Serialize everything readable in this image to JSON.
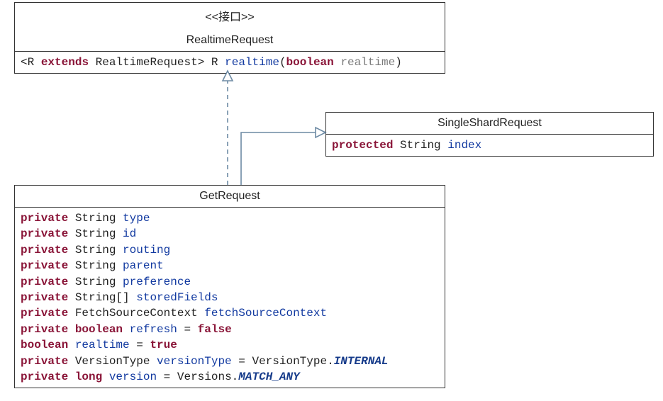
{
  "interface": {
    "stereotype": "<<接口>>",
    "name": "RealtimeRequest",
    "method": {
      "prefix": "<",
      "generic": "R",
      "extends_kw": "extends",
      "extends_type": "RealtimeRequest",
      "close": ">",
      "return": "R",
      "method_name": "realtime",
      "param_type_kw": "boolean",
      "param_name": "realtime"
    }
  },
  "singleShard": {
    "name": "SingleShardRequest",
    "field": {
      "mod": "protected",
      "type": "String",
      "name": "index"
    }
  },
  "getRequest": {
    "name": "GetRequest",
    "fields": [
      {
        "mod": "private",
        "type": "String",
        "name": "type"
      },
      {
        "mod": "private",
        "type": "String",
        "name": "id"
      },
      {
        "mod": "private",
        "type": "String",
        "name": "routing"
      },
      {
        "mod": "private",
        "type": "String",
        "name": "parent"
      },
      {
        "mod": "private",
        "type": "String",
        "name": "preference"
      },
      {
        "mod": "private",
        "type": "String[]",
        "name": "storedFields"
      },
      {
        "mod": "private",
        "type": "FetchSourceContext",
        "name": "fetchSourceContext"
      },
      {
        "mod": "private",
        "type_kw": "boolean",
        "name": "refresh",
        "eq": "=",
        "lit": "false"
      },
      {
        "type_kw": "boolean",
        "name": "realtime",
        "eq": "=",
        "lit": "true"
      },
      {
        "mod": "private",
        "type": "VersionType",
        "name": "versionType",
        "eq": "=",
        "rhs_type": "VersionType",
        "dot": ".",
        "rhs_enum": "INTERNAL"
      },
      {
        "mod": "private",
        "type_kw": "long",
        "name": "version",
        "eq": "=",
        "rhs_type": "Versions",
        "dot": ".",
        "rhs_enum": "MATCH_ANY"
      }
    ]
  }
}
